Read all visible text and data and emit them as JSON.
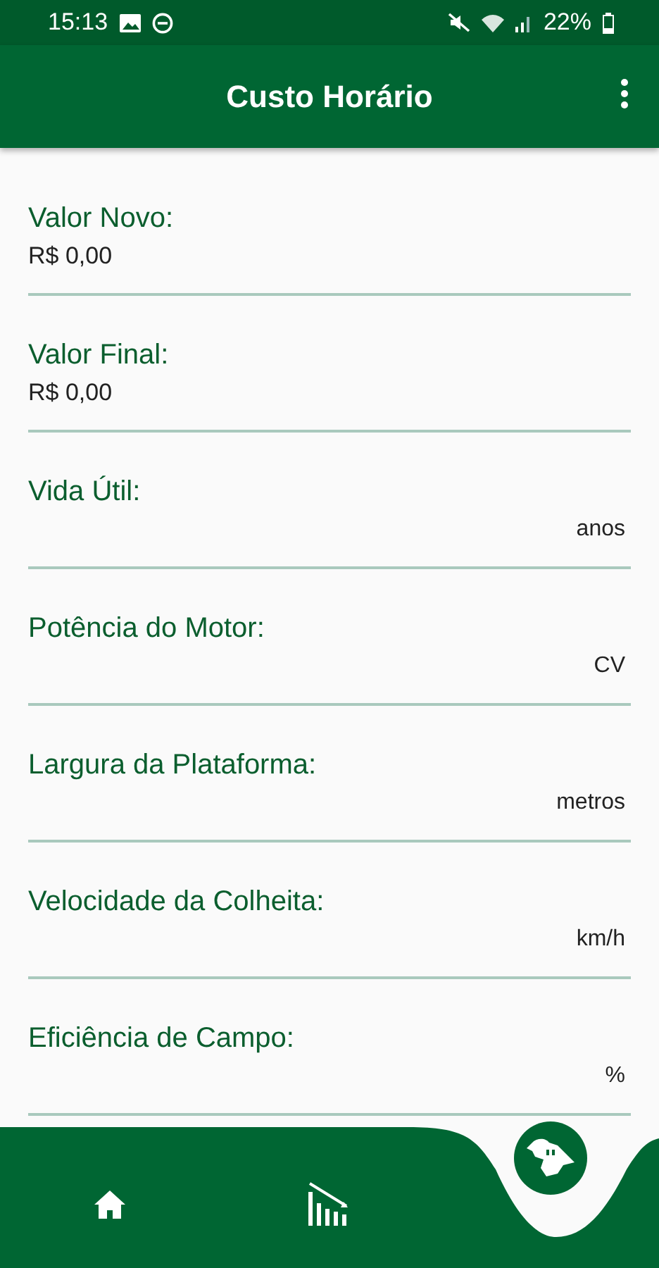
{
  "status_bar": {
    "time": "15:13",
    "battery": "22%"
  },
  "app_bar": {
    "title": "Custo Horário"
  },
  "fields": [
    {
      "label": "Valor Novo:",
      "kind": "value",
      "text": "R$ 0,00"
    },
    {
      "label": "Valor Final:",
      "kind": "value",
      "text": "R$ 0,00"
    },
    {
      "label": "Vida Útil:",
      "kind": "unit",
      "text": "anos"
    },
    {
      "label": "Potência do Motor:",
      "kind": "unit",
      "text": "CV"
    },
    {
      "label": "Largura da Plataforma:",
      "kind": "unit",
      "text": "metros"
    },
    {
      "label": "Velocidade da Colheita:",
      "kind": "unit",
      "text": "km/h"
    },
    {
      "label": "Eficiência de Campo:",
      "kind": "unit",
      "text": "%"
    }
  ]
}
